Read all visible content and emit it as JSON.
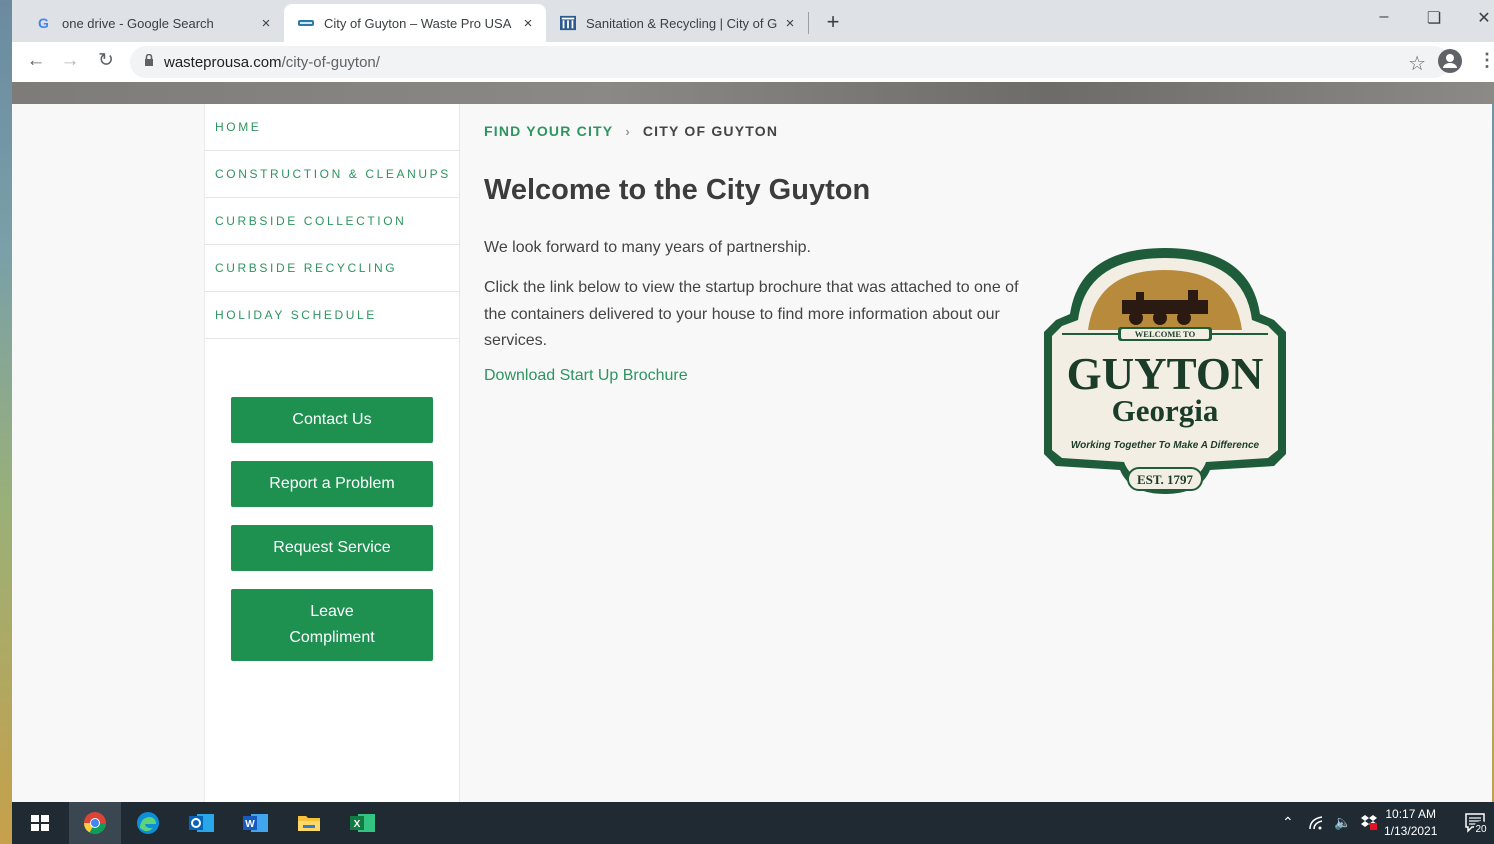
{
  "browser": {
    "tabs": [
      {
        "title": "one drive - Google Search",
        "close": "×"
      },
      {
        "title": "City of Guyton – Waste Pro USA",
        "close": "×"
      },
      {
        "title": "Sanitation & Recycling | City of G",
        "close": "×"
      }
    ],
    "new_tab": "+",
    "url_domain": "wasteprousa.com",
    "url_path": "/city-of-guyton/"
  },
  "sidebar": {
    "nav": [
      {
        "label": "HOME"
      },
      {
        "label": "CONSTRUCTION & CLEANUPS"
      },
      {
        "label": "CURBSIDE COLLECTION"
      },
      {
        "label": "CURBSIDE RECYCLING"
      },
      {
        "label": "HOLIDAY SCHEDULE"
      }
    ],
    "buttons": {
      "contact": "Contact Us",
      "report": "Report a Problem",
      "request": "Request Service",
      "compliment_1": "Leave",
      "compliment_2": "Compliment"
    }
  },
  "main": {
    "breadcrumb_parent": "FIND YOUR CITY",
    "breadcrumb_sep": "›",
    "breadcrumb_current": "CITY OF GUYTON",
    "title": "Welcome to the City Guyton",
    "para1": "We look forward to many years of partnership.",
    "para2": "Click the link below to view the startup brochure that was attached to one of the containers delivered to your house to find more information about our services.",
    "link": "Download Start Up Brochure"
  },
  "logo": {
    "welcome": "WELCOME TO",
    "name": "GUYTON",
    "state": "Georgia",
    "motto": "Working Together To Make A Difference",
    "est": "EST. 1797",
    "colors": {
      "border": "#1f5c3a",
      "fill": "#f2eee4",
      "text": "#1a3c28"
    }
  },
  "taskbar": {
    "time": "10:17 AM",
    "date": "1/13/2021",
    "notifications": "20"
  },
  "colors": {
    "accent": "#1e9150",
    "link": "#2e9460"
  }
}
